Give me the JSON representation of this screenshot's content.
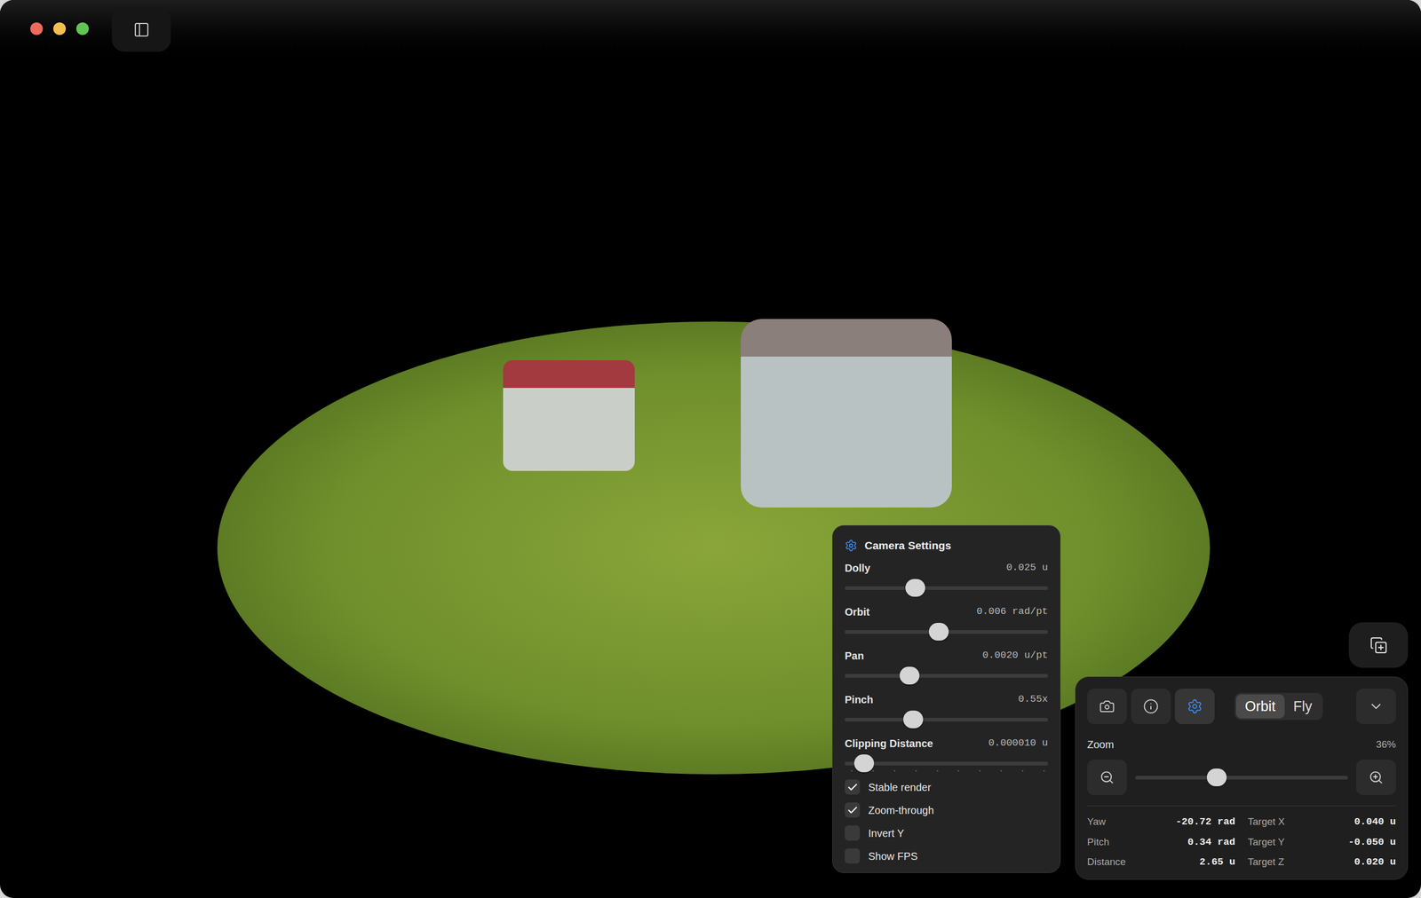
{
  "window": {
    "controls": [
      {
        "color": "#ed6a5e"
      },
      {
        "color": "#f5bf4f"
      },
      {
        "color": "#61c554"
      }
    ]
  },
  "camera_settings": {
    "title": "Camera Settings",
    "sliders": [
      {
        "label": "Dolly",
        "reading": "0.025 u",
        "level": 0.33,
        "kind": "plain"
      },
      {
        "label": "Orbit",
        "reading": "0.006 rad/pt",
        "level": 0.46,
        "kind": "plain"
      },
      {
        "label": "Pan",
        "reading": "0.0020 u/pt",
        "level": 0.3,
        "kind": "plain"
      },
      {
        "label": "Pinch",
        "reading": "0.55x",
        "level": 0.32,
        "kind": "plain"
      },
      {
        "label": "Clipping Distance",
        "reading": "0.000010 u",
        "level": 0.05,
        "kind": "stepped"
      }
    ],
    "checkboxes": [
      {
        "label": "Stable render",
        "checked": true
      },
      {
        "label": "Zoom-through",
        "checked": true
      },
      {
        "label": "Invert Y",
        "checked": false
      },
      {
        "label": "Show FPS",
        "checked": false
      }
    ]
  },
  "view_panel": {
    "tools": [
      {
        "kind": "camera",
        "selected": false
      },
      {
        "kind": "info",
        "selected": false
      },
      {
        "kind": "settings",
        "selected": true
      }
    ],
    "modes": [
      {
        "label": "Orbit",
        "selected": true
      },
      {
        "label": "Fly",
        "selected": false
      }
    ],
    "zoom": {
      "label": "Zoom",
      "reading": "36%",
      "level": 0.37
    },
    "stats": [
      [
        {
          "label": "Yaw",
          "value": "-20.72 rad"
        },
        {
          "label": "Target X",
          "value": "0.040 u"
        }
      ],
      [
        {
          "label": "Pitch",
          "value": "0.34 rad"
        },
        {
          "label": "Target Y",
          "value": "-0.050 u"
        }
      ],
      [
        {
          "label": "Distance",
          "value": "2.65 u"
        },
        {
          "label": "Target Z",
          "value": "0.020 u"
        }
      ]
    ]
  }
}
